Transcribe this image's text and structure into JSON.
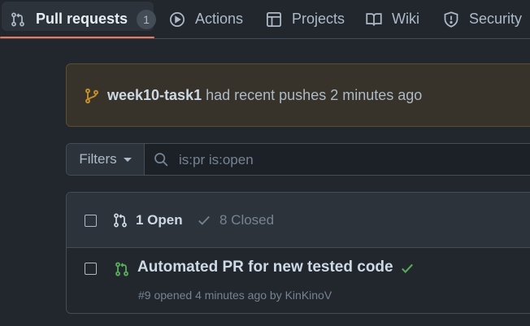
{
  "nav": {
    "tabs": [
      {
        "label": "Pull requests",
        "icon": "git-pull-request-icon",
        "counter": "1",
        "active": true
      },
      {
        "label": "Actions",
        "icon": "play-icon"
      },
      {
        "label": "Projects",
        "icon": "table-icon"
      },
      {
        "label": "Wiki",
        "icon": "book-icon"
      },
      {
        "label": "Security",
        "icon": "shield-icon"
      }
    ]
  },
  "banner": {
    "branch": "week10-task1",
    "message": " had recent pushes 2 minutes ago",
    "icon": "git-branch-icon"
  },
  "filter": {
    "button_label": "Filters",
    "search_value": "is:pr is:open"
  },
  "list": {
    "open_label": "1 Open",
    "closed_label": "8 Closed",
    "items": [
      {
        "title": "Automated PR for new tested code",
        "meta": "#9 opened 4 minutes ago by KinKinoV",
        "status": "success-check-icon"
      }
    ]
  },
  "colors": {
    "background": "#22272e",
    "accent_underline": "#ec775c",
    "banner_icon": "#c69026",
    "open_green": "#57ab5a"
  }
}
